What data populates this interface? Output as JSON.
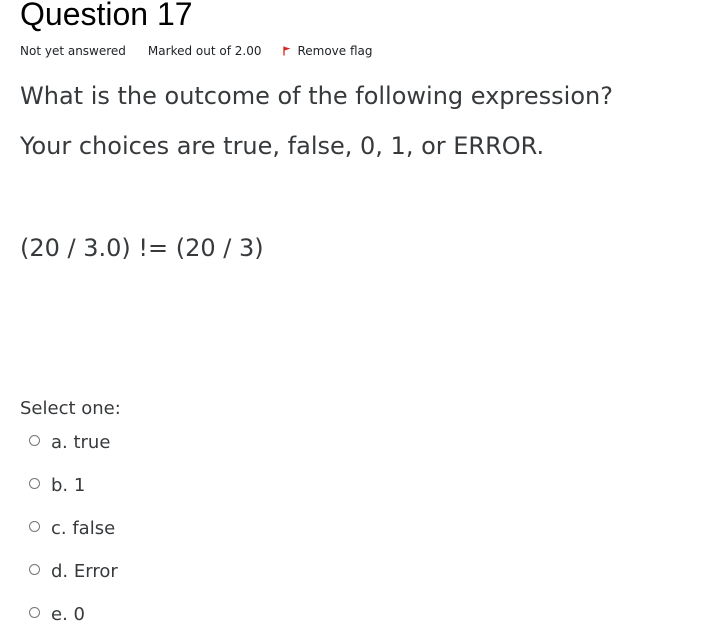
{
  "question": {
    "title": "Question 17",
    "state": "Not yet answered",
    "grade": "Marked out of 2.00",
    "flag_label": "Remove flag",
    "flag_icon": "flag-icon",
    "flag_color": "#d9231d",
    "text_lines": [
      "What is the outcome of the following expression?",
      "Your choices are true, false, 0, 1, or  ERROR.",
      "(20 / 3.0) != (20 / 3)"
    ],
    "prompt": "Select one:",
    "options": [
      {
        "label": "a. true",
        "selected": false
      },
      {
        "label": "b. 1",
        "selected": false
      },
      {
        "label": "c. false",
        "selected": false
      },
      {
        "label": "d. Error",
        "selected": false
      },
      {
        "label": "e. 0",
        "selected": false
      }
    ]
  }
}
